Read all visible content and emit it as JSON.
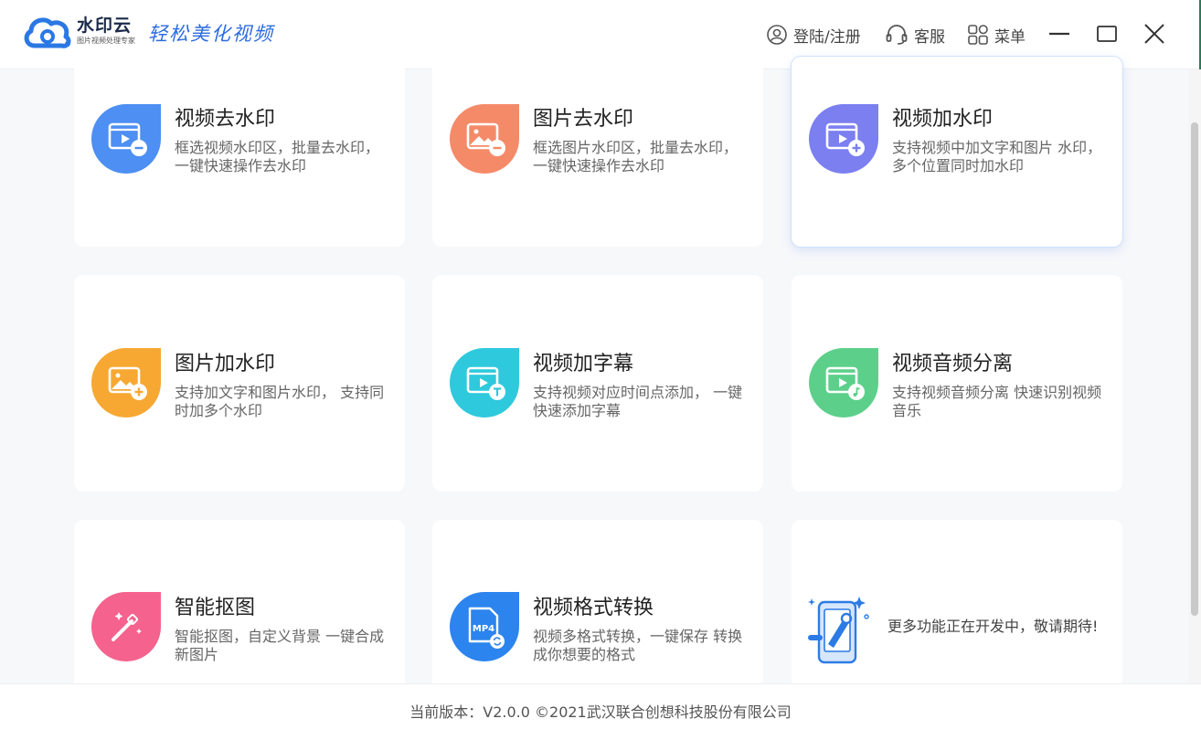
{
  "app": {
    "brand_name": "水印云",
    "brand_sub": "图片视频处理专家",
    "slogan": "轻松美化视频"
  },
  "header": {
    "login_label": "登陆/注册",
    "service_label": "客服",
    "menu_label": "菜单"
  },
  "features": [
    {
      "title": "视频去水印",
      "desc": "框选视频水印区，批量去水印， 一键快速操作去水印",
      "icon": "video-remove-icon",
      "color": "#4d8ff2"
    },
    {
      "title": "图片去水印",
      "desc": "框选图片水印区，批量去水印， 一键快速操作去水印",
      "icon": "image-remove-icon",
      "color": "#f58a68"
    },
    {
      "title": "视频加水印",
      "desc": "支持视频中加文字和图片 水印，多个位置同时加水印",
      "icon": "video-add-icon",
      "color": "#7b7ff0"
    },
    {
      "title": "图片加水印",
      "desc": "支持加文字和图片水印， 支持同时加多个水印",
      "icon": "image-add-icon",
      "color": "#f7a832"
    },
    {
      "title": "视频加字幕",
      "desc": "支持视频对应时间点添加， 一键快速添加字幕",
      "icon": "video-subtitle-icon",
      "color": "#2ec9dc"
    },
    {
      "title": "视频音频分离",
      "desc": "支持视频音频分离 快速识别视频音乐",
      "icon": "video-audio-icon",
      "color": "#5cd08a"
    },
    {
      "title": "智能抠图",
      "desc": "智能抠图，自定义背景 一键合成新图片",
      "icon": "magic-wand-icon",
      "color": "#f5628e"
    },
    {
      "title": "视频格式转换",
      "desc": "视频多格式转换，一键保存 转换成你想要的格式",
      "icon": "mp4-convert-icon",
      "color": "#2c84ee"
    }
  ],
  "coming_soon": {
    "text": "更多功能正在开发中，敬请期待!",
    "icon": "phone-tools-icon"
  },
  "footer": {
    "text": "当前版本：V2.0.0 ©2021武汉联合创想科技股份有限公司"
  }
}
